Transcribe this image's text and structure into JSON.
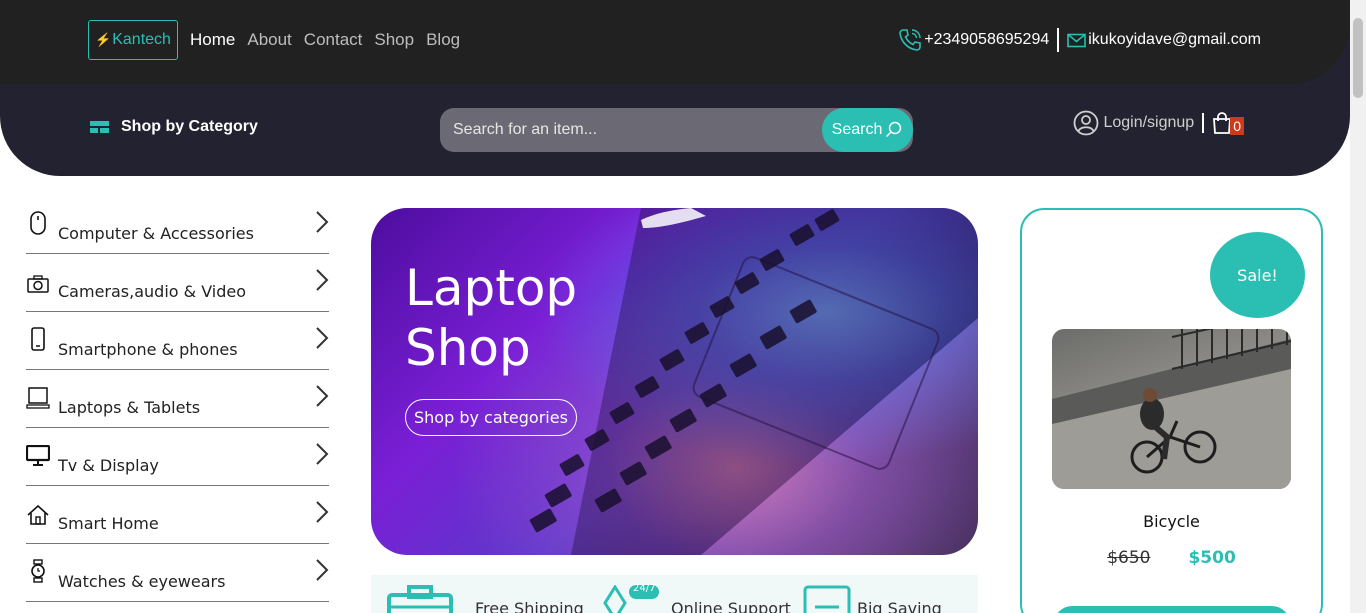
{
  "header": {
    "brand": "Kantech",
    "nav": [
      "Home",
      "About",
      "Contact",
      "Shop",
      "Blog"
    ],
    "phone": "+2349058695294",
    "email": "ikukoyidave@gmail.com"
  },
  "subheader": {
    "category_toggle": "Shop by Category",
    "search_placeholder": "Search for an item...",
    "search_button": "Search",
    "login": "Login/signup",
    "cart_count": "0"
  },
  "sidebar": {
    "categories": [
      {
        "label": "Computer & Accessories",
        "icon": "mouse-icon"
      },
      {
        "label": "Cameras,audio & Video",
        "icon": "camera-icon"
      },
      {
        "label": "Smartphone & phones",
        "icon": "smartphone-icon"
      },
      {
        "label": "Laptops & Tablets",
        "icon": "laptop-icon"
      },
      {
        "label": "Tv & Display",
        "icon": "monitor-icon"
      },
      {
        "label": "Smart Home",
        "icon": "home-icon"
      },
      {
        "label": "Watches & eyewears",
        "icon": "watch-icon"
      }
    ]
  },
  "hero": {
    "title_line1": "Laptop",
    "title_line2": "Shop",
    "button": "Shop by categories"
  },
  "features": {
    "free_shipping": "Free Shipping",
    "badge_247": "24/7",
    "online_support": "Online Support",
    "big_saving": "Big Saving"
  },
  "sale_card": {
    "badge": "Sale!",
    "product_name": "Bicycle",
    "old_price": "$650",
    "new_price": "$500"
  },
  "colors": {
    "accent": "#2bbfb3",
    "topbar": "#212121",
    "subbar": "#232230",
    "cart_badge": "#cc3a1b"
  }
}
